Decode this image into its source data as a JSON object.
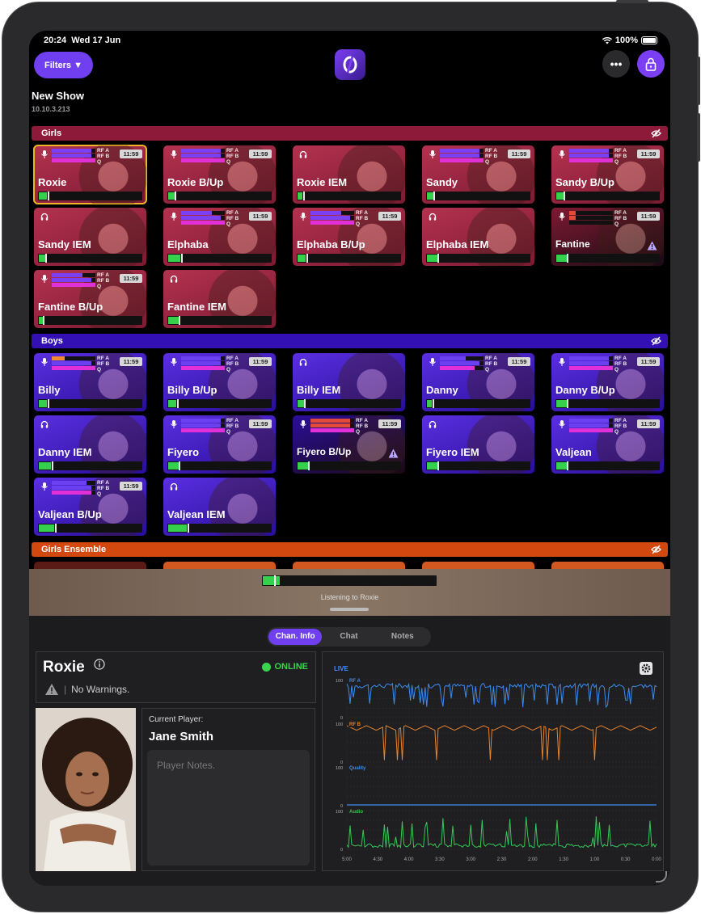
{
  "status_bar": {
    "time": "20:24",
    "date": "Wed 17 Jun",
    "battery": "100%"
  },
  "toolbar": {
    "filters_label": "Filters ▼",
    "more_label": "•••"
  },
  "show": {
    "title": "New Show",
    "ip": "10.10.3.213"
  },
  "groups": [
    {
      "name": "Girls",
      "color": "#8e1a39"
    },
    {
      "name": "Boys",
      "color": "#3210b3"
    },
    {
      "name": "Girls Ensemble",
      "color": "#d2480f"
    }
  ],
  "tile_labels": {
    "rf_a": "RF A",
    "rf_b": "RF B",
    "q": "Q",
    "time": "11:59"
  },
  "channels": [
    {
      "name": "Roxie",
      "type": "mic",
      "rfa": 0.9,
      "rfb": 0.9,
      "q": 1.0,
      "audio": 0.08,
      "selected": true
    },
    {
      "name": "Roxie B/Up",
      "type": "mic",
      "rfa": 0.9,
      "rfb": 0.9,
      "q": 1.0,
      "audio": 0.06
    },
    {
      "name": "Roxie IEM",
      "type": "iem",
      "audio": 0.05
    },
    {
      "name": "Sandy",
      "type": "mic",
      "rfa": 0.9,
      "rfb": 0.9,
      "q": 1.0,
      "audio": 0.06
    },
    {
      "name": "Sandy B/Up",
      "type": "mic",
      "rfa": 0.9,
      "rfb": 0.9,
      "q": 1.0,
      "audio": 0.07
    },
    {
      "name": "Sandy IEM",
      "type": "iem",
      "audio": 0.06
    },
    {
      "name": "Elphaba",
      "type": "mic",
      "rfa": 0.7,
      "rfb": 0.9,
      "q": 1.0,
      "audio": 0.12
    },
    {
      "name": "Elphaba B/Up",
      "type": "mic",
      "rfa": 0.7,
      "rfb": 0.9,
      "q": 1.0,
      "audio": 0.08
    },
    {
      "name": "Elphaba IEM",
      "type": "iem",
      "audio": 0.1
    },
    {
      "name": "Fantine",
      "type": "mic",
      "rfa": 0.15,
      "rfb": 0.15,
      "q": 0.0,
      "audio": 0.1,
      "warning": true,
      "dim": true
    },
    {
      "name": "Fantine B/Up",
      "type": "mic",
      "rfa": 0.7,
      "rfb": 0.9,
      "q": 1.0,
      "audio": 0.04
    },
    {
      "name": "Fantine IEM",
      "type": "iem",
      "audio": 0.1
    },
    {
      "name": "Billy",
      "type": "mic",
      "rfa": 0.3,
      "rfb": 0.9,
      "q": 1.0,
      "audio": 0.08
    },
    {
      "name": "Billy B/Up",
      "type": "mic",
      "rfa": 0.9,
      "rfb": 0.9,
      "q": 1.0,
      "audio": 0.08
    },
    {
      "name": "Billy IEM",
      "type": "iem",
      "audio": 0.06
    },
    {
      "name": "Danny",
      "type": "mic",
      "rfa": 0.6,
      "rfb": 0.9,
      "q": 0.8,
      "audio": 0.05
    },
    {
      "name": "Danny B/Up",
      "type": "mic",
      "rfa": 0.9,
      "rfb": 0.9,
      "q": 1.0,
      "audio": 0.1
    },
    {
      "name": "Danny IEM",
      "type": "iem",
      "audio": 0.12
    },
    {
      "name": "Fiyero",
      "type": "mic",
      "rfa": 0.9,
      "rfb": 0.9,
      "q": 1.0,
      "audio": 0.1
    },
    {
      "name": "Fiyero B/Up",
      "type": "mic",
      "rfa": 0.9,
      "rfb": 0.9,
      "q": 1.0,
      "audio": 0.1,
      "warning": true,
      "dim": true
    },
    {
      "name": "Fiyero IEM",
      "type": "iem",
      "audio": 0.1
    },
    {
      "name": "Valjean",
      "type": "mic",
      "rfa": 0.9,
      "rfb": 0.9,
      "q": 1.0,
      "audio": 0.1
    },
    {
      "name": "Valjean B/Up",
      "type": "mic",
      "rfa": 0.8,
      "rfb": 0.9,
      "q": 0.9,
      "audio": 0.15
    },
    {
      "name": "Valjean IEM",
      "type": "iem",
      "audio": 0.18
    }
  ],
  "player_strip": {
    "listening_label": "Listening to Roxie",
    "audio": 0.1
  },
  "tabs": [
    {
      "label": "Chan. Info",
      "active": true
    },
    {
      "label": "Chat",
      "active": false
    },
    {
      "label": "Notes",
      "active": false
    }
  ],
  "channel_info": {
    "name": "Roxie",
    "status": "ONLINE",
    "warning_text": "No Warnings.",
    "current_player_label": "Current Player:",
    "player_name": "Jane Smith",
    "notes_placeholder": "Player Notes."
  },
  "graph": {
    "live_label": "LIVE",
    "panels": [
      {
        "name": "RF A",
        "color": "#3a8cf0",
        "max_label": "100",
        "min_label": "0"
      },
      {
        "name": "RF B",
        "color": "#e8832e",
        "max_label": "100",
        "min_label": "0"
      },
      {
        "name": "Quality",
        "color": "#3a8cf0",
        "max_label": "100",
        "min_label": "0"
      },
      {
        "name": "Audio",
        "color": "#34c759",
        "max_label": "100",
        "min_label": "0"
      }
    ],
    "x_ticks": [
      "5:00",
      "4:30",
      "4:00",
      "3:30",
      "3:00",
      "2:30",
      "2:00",
      "1:30",
      "1:00",
      "0:30",
      "0:00"
    ]
  }
}
